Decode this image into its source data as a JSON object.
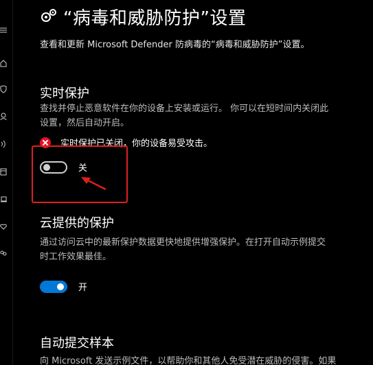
{
  "header": {
    "title": "“病毒和威胁防护”设置",
    "subtitle": "查看和更新 Microsoft Defender 防病毒的“病毒和威胁防护”设置。",
    "icon": "gear-icon"
  },
  "nav": {
    "icons": [
      "menu-icon",
      "home-icon",
      "shield-icon",
      "person-icon",
      "wireless-icon",
      "app-browser-icon",
      "laptop-icon",
      "heart-icon",
      "family-icon"
    ]
  },
  "realtime": {
    "heading": "实时保护",
    "desc_line1": "查找并停止恶意软件在你的设备上安装或运行。 你可以在短时间内关闭此",
    "desc_line2": "设置，然后自动开启。",
    "warning": "实时保护已关闭，你的设备易受攻击。",
    "toggle_state": "off",
    "toggle_label": "关"
  },
  "cloud": {
    "heading": "云提供的保护",
    "desc_line1": "通过访问云中的最新保护数据更快地提供增强保护。在打开自动示例提交",
    "desc_line2": "时工作效果最佳。",
    "toggle_state": "on",
    "toggle_label": "开"
  },
  "auto_sample": {
    "heading": "自动提交样本",
    "desc_line1": "向 Microsoft 发送示例文件，以帮助你和其他人免受潜在威胁的侵害。如果"
  },
  "colors": {
    "accent": "#0078d7",
    "error": "#e81123",
    "annotation": "#e0201e"
  }
}
